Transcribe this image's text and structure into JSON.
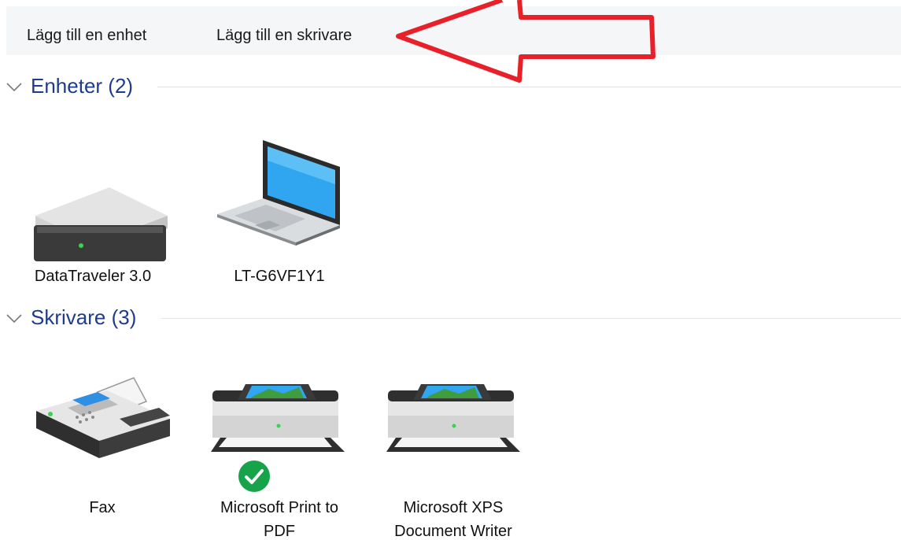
{
  "toolbar": {
    "add_device": "Lägg till en enhet",
    "add_printer": "Lägg till en skrivare"
  },
  "colors": {
    "group_header": "#1e3c8c",
    "annotation": "#e8202a",
    "check_badge": "#16a34a"
  },
  "groups": [
    {
      "title": "Enheter (2)",
      "items": [
        {
          "label": "DataTraveler 3.0",
          "icon": "usb-drive-icon"
        },
        {
          "label": "LT-G6VF1Y1",
          "icon": "laptop-icon"
        }
      ]
    },
    {
      "title": "Skrivare (3)",
      "items": [
        {
          "label": "Fax",
          "icon": "fax-icon"
        },
        {
          "label": "Microsoft Print to PDF",
          "icon": "printer-icon",
          "default": true
        },
        {
          "label": "Microsoft XPS Document Writer",
          "icon": "printer-icon"
        }
      ]
    }
  ]
}
